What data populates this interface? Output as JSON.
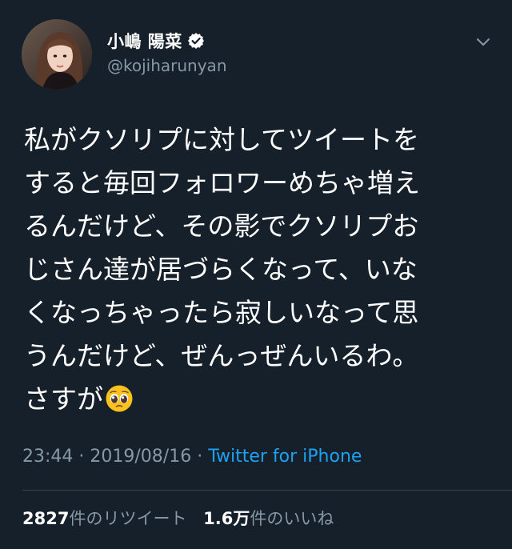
{
  "author": {
    "display_name": "小嶋 陽菜",
    "handle": "@kojiharunyan",
    "verified": true,
    "avatar_icon": "profile-photo"
  },
  "tweet": {
    "text": "私がクソリプに対してツイートをすると毎回フォロワーめちゃ増えるんだけど、その影でクソリプおじさん達が居づらくなって、いなくなっちゃったら寂しいなって思うんだけど、ぜんっぜんいるわ。さすが",
    "lines": [
      "私がクソリプに対してツイートを",
      "すると毎回フォロワーめちゃ増え",
      "るんだけど、その影でクソリプお",
      "じさん達が居づらくなって、いな",
      "くなっちゃったら寂しいなって思",
      "うんだけど、ぜんっぜんいるわ。",
      "さすが"
    ],
    "trailing_emoji": "pleading-face-emoji"
  },
  "meta": {
    "time": "23:44",
    "separator": " · ",
    "date": "2019/08/16",
    "source": "Twitter for iPhone"
  },
  "stats": {
    "retweets_count": "2827",
    "retweets_label": "件のリツイート",
    "likes_count": "1.6万",
    "likes_label": "件のいいね"
  },
  "colors": {
    "background": "#15202b",
    "text": "#ffffff",
    "secondary": "#8899a6",
    "link": "#1da1f2",
    "divider": "#38444d",
    "verified_badge": "#ffffff"
  }
}
